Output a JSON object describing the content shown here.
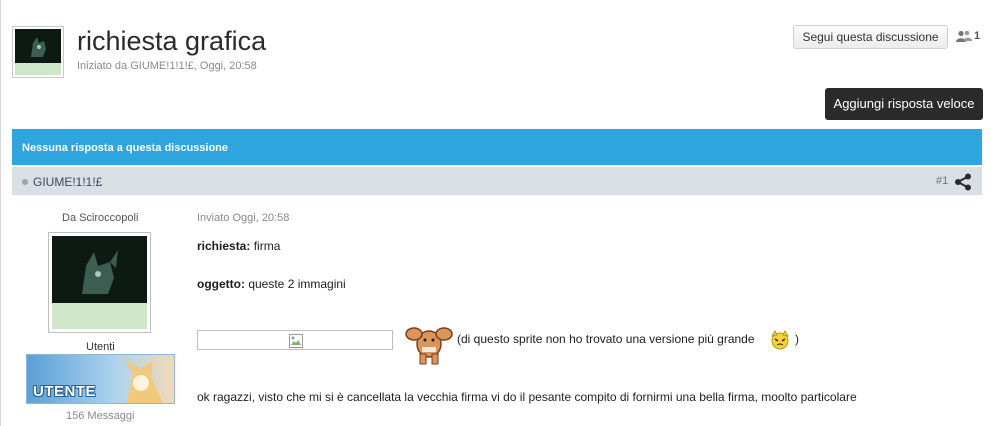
{
  "topic": {
    "title": "richiesta grafica",
    "meta": "Iniziato da GIUME!1!1!£, Oggi, 20:58",
    "follow_label": "Segui questa discussione",
    "followers_count": "1",
    "reply_label": "Aggiungi risposta veloce",
    "status_text": "Nessuna risposta a questa discussione"
  },
  "post": {
    "author": "GIUME!1!1!£",
    "number": "#1",
    "from_text": "Da Sciroccopoli",
    "group": "Utenti",
    "rank_label": "UTENTE",
    "post_count": "156 Messaggi",
    "date": "Inviato Oggi, 20:58",
    "request_label": "richiesta:",
    "request_value": "firma",
    "object_label": "oggetto:",
    "object_value": "queste 2 immagini",
    "sprite_note": "(di questo sprite non ho trovato una versione più grande",
    "sprite_note_close": ")",
    "body_text": "ok ragazzi, visto che mi si è cancellata la vecchia firma vi do il pesante compito di fornirmi una bella firma, moolto particolare"
  },
  "colors": {
    "status_bar": "#2ea5df",
    "post_header": "#dadee5",
    "reply_button": "#2b2b2b"
  }
}
